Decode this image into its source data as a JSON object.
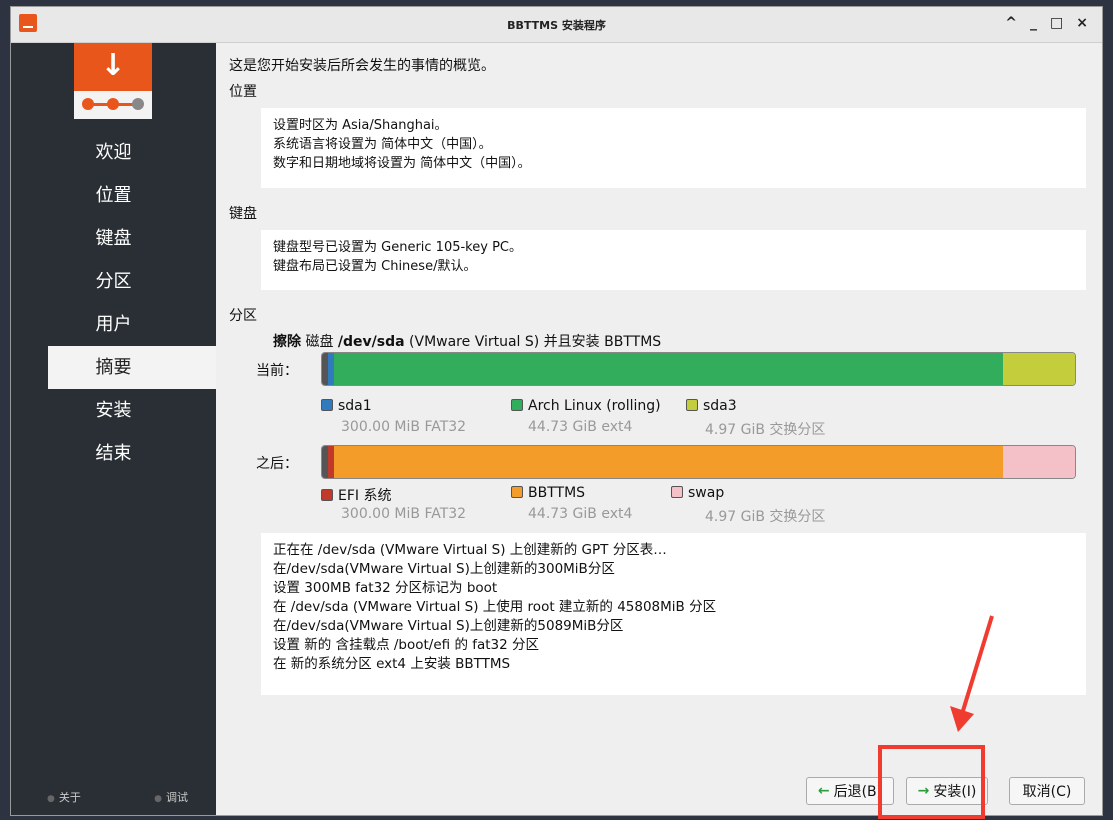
{
  "window": {
    "title": "BBTTMS 安装程序",
    "controls": [
      "^",
      "_",
      "□",
      "×"
    ]
  },
  "sidebar": {
    "items": [
      {
        "label": "欢迎",
        "active": false
      },
      {
        "label": "位置",
        "active": false
      },
      {
        "label": "键盘",
        "active": false
      },
      {
        "label": "分区",
        "active": false
      },
      {
        "label": "用户",
        "active": false
      },
      {
        "label": "摘要",
        "active": true
      },
      {
        "label": "安装",
        "active": false
      },
      {
        "label": "结束",
        "active": false
      }
    ],
    "about_label": "关于",
    "debug_label": "调试"
  },
  "summary": {
    "intro": "这是您开始安装后所会发生的事情的概览。",
    "location": {
      "heading": "位置",
      "lines": [
        "设置时区为 Asia/Shanghai。",
        "系统语言将设置为 简体中文（中国）。",
        "数字和日期地域将设置为 简体中文（中国）。"
      ]
    },
    "keyboard": {
      "heading": "键盘",
      "lines": [
        "键盘型号已设置为 Generic 105-key PC。",
        "键盘布局已设置为 Chinese/默认。"
      ]
    },
    "partition": {
      "heading": "分区",
      "erase_prefix": "擦除",
      "erase_disk": "磁盘",
      "erase_dev": "/dev/sda",
      "erase_rest": "(VMware Virtual S) 并且安装 BBTTMS",
      "current_label": "当前：",
      "after_label": "之后：",
      "current_legend": [
        {
          "name": "sda1",
          "detail": "300.00 MiB  FAT32",
          "color": "#2f7bbd"
        },
        {
          "name": "Arch Linux (rolling)",
          "detail": "44.73 GiB  ext4",
          "color": "#31ad5b"
        },
        {
          "name": "sda3",
          "detail": "4.97 GiB  交换分区",
          "color": "#c4ce3c"
        }
      ],
      "after_legend": [
        {
          "name": "EFI 系统",
          "detail": "300.00 MiB  FAT32",
          "color": "#c0392b"
        },
        {
          "name": "BBTTMS",
          "detail": "44.73 GiB  ext4",
          "color": "#f39c2a"
        },
        {
          "name": "swap",
          "detail": "4.97 GiB  交换分区",
          "color": "#f4c1c9"
        }
      ]
    },
    "operations": [
      "正在在 /dev/sda (VMware Virtual S) 上创建新的 GPT 分区表…",
      "在/dev/sda(VMware Virtual S)上创建新的300MiB分区",
      "设置 300MB fat32 分区标记为 boot",
      "在 /dev/sda (VMware Virtual S) 上使用 root 建立新的 45808MiB 分区",
      "在/dev/sda(VMware Virtual S)上创建新的5089MiB分区",
      "设置 新的 含挂载点 /boot/efi 的 fat32 分区",
      "在 新的系统分区 ext4 上安装 BBTTMS"
    ]
  },
  "buttons": {
    "back": "后退(B)",
    "install": "安装(I)",
    "cancel": "取消(C)"
  },
  "icons": {
    "back": "arrow-left-icon",
    "install": "arrow-right-icon",
    "logo": "download-arrow-icon"
  }
}
